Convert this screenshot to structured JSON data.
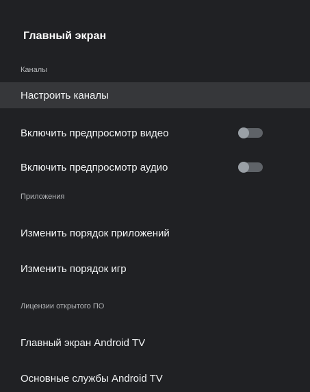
{
  "screen": {
    "title": "Главный экран"
  },
  "sections": {
    "channels": "Каналы",
    "apps": "Приложения",
    "licenses": "Лицензии открытого ПО"
  },
  "items": {
    "setup_channels": "Настроить каналы",
    "video_preview": "Включить предпросмотр видео",
    "audio_preview": "Включить предпросмотр аудио",
    "reorder_apps": "Изменить порядок приложений",
    "reorder_games": "Изменить порядок игр",
    "home_android_tv": "Главный экран Android TV",
    "core_services": "Основные службы Android TV"
  },
  "toggles": {
    "video_preview_on": false,
    "audio_preview_on": false
  },
  "colors": {
    "background": "#202124",
    "focused_row": "#36373a",
    "section_text": "#b5b7ba",
    "toggle_track": "#5f6368",
    "toggle_knob": "#9aa0a6"
  }
}
